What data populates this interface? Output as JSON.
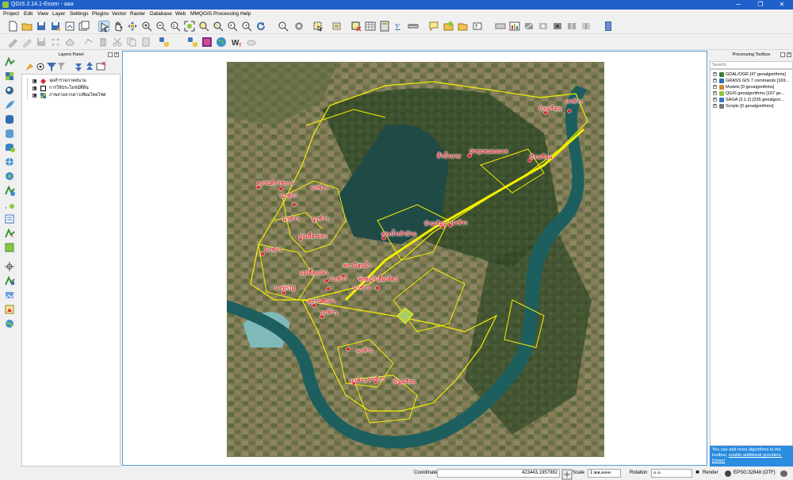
{
  "window": {
    "title": "QGIS 2.14.1-Essen - aaa",
    "minimize": "─",
    "maximize": "❐",
    "close": "✕"
  },
  "menu": [
    "Project",
    "Edit",
    "View",
    "Layer",
    "Settings",
    "Plugins",
    "Vector",
    "Raster",
    "Database",
    "Web",
    "MMQGIS",
    "Processing",
    "Help"
  ],
  "layers_panel": {
    "title": "Layers Panel",
    "layers": [
      {
        "name": "จุดสำรวจภาคสนาม",
        "checked": "✖",
        "symbol": "red-diamond"
      },
      {
        "name": "การใช้ประโยชน์ที่ดิน",
        "checked": "✖",
        "symbol": "polygon-outline"
      },
      {
        "name": "ภาพถ่ายจากดาวเทียมไทยโชต",
        "checked": "✖",
        "symbol": "raster"
      }
    ]
  },
  "map": {
    "places": [
      {
        "label": "นาข้าว"
      },
      {
        "label": "บ้านเรือน"
      },
      {
        "label": "ป่าชุมชนดงนาค"
      },
      {
        "label": "ลำน้ำนาย"
      },
      {
        "label": "บ้านเรือน"
      },
      {
        "label": "สถานที่ราชการ"
      },
      {
        "label": "นาข้าว"
      },
      {
        "label": "นาข้าว"
      },
      {
        "label": "นาข้าว"
      },
      {
        "label": "นาข้าว"
      },
      {
        "label": "บ่อเลี้ยงปลา"
      },
      {
        "label": "นาข้าว"
      },
      {
        "label": "สระน้ำเจ้าบ้าน"
      },
      {
        "label": "บ้านเรือน"
      },
      {
        "label": "นาข้าว"
      },
      {
        "label": "นาข้าว"
      },
      {
        "label": "สถานีสูบน้ำ"
      },
      {
        "label": "บ่อเลี้ยงปลา"
      },
      {
        "label": "นาข้าว"
      },
      {
        "label": "ทุ่งหญ้าเลี้ยงสัตว์"
      },
      {
        "label": "นาข้าว"
      },
      {
        "label": "ป่าไม้"
      },
      {
        "label": "สถานศึกษา"
      },
      {
        "label": "นาข้าว"
      },
      {
        "label": "นาข้าว"
      },
      {
        "label": "นาข้าว"
      },
      {
        "label": "นาข้าว"
      },
      {
        "label": "บ้านเรือน"
      }
    ]
  },
  "toolbox": {
    "title": "Processing Toolbox",
    "search_placeholder": "Search...",
    "providers": [
      {
        "label": "GDAL/OGR [47 geoalgorithms]",
        "color": "#3b7d3b"
      },
      {
        "label": "GRASS GIS 7 commands [169...",
        "color": "#2c6db0"
      },
      {
        "label": "Models [0 geoalgorithms]",
        "color": "#d08a2c"
      },
      {
        "label": "QGIS geoalgorithms [107 ge...",
        "color": "#8fc63f"
      },
      {
        "label": "SAGA (2.1.2) [235 geoalgori...",
        "color": "#3a78c0"
      },
      {
        "label": "Scripts [0 geoalgorithms]",
        "color": "#777777"
      }
    ],
    "info_text": "You can add more algorithms to the toolbox,",
    "info_link1": "enable additional providers.",
    "info_link2": "[close]"
  },
  "status": {
    "coordinate_label": "Coordinate",
    "coordinate_value": "423443,1957982",
    "scale_label": "Scale",
    "scale_value": "1:๑๑,๓๓๓",
    "rotation_label": "Rotation",
    "rotation_value": "๐.๐",
    "render_label": "Render",
    "crs_label": "EPSG:32648 (OTF)"
  }
}
